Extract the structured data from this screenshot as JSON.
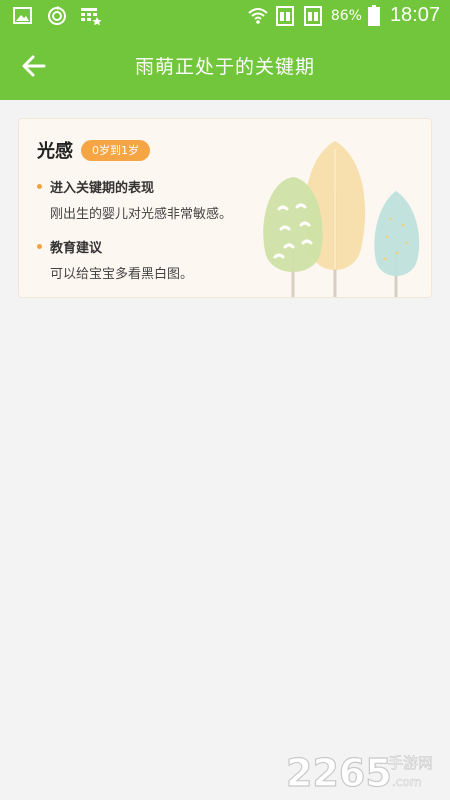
{
  "status_bar": {
    "battery_percent": "86%",
    "time": "18:07",
    "left_icons": [
      "image-icon",
      "refresh-icon",
      "app-grid-star-icon"
    ],
    "right_icons": [
      "wifi-icon",
      "sim1-icon",
      "sim2-icon",
      "battery-icon"
    ]
  },
  "app_bar": {
    "title": "雨萌正处于的关键期",
    "back_icon": "arrow-left-icon"
  },
  "card": {
    "title": "光感",
    "age_badge": "0岁到1岁",
    "sections": [
      {
        "heading": "进入关键期的表现",
        "text": "刚出生的婴儿对光感非常敏感。"
      },
      {
        "heading": "教育建议",
        "text": "可以给宝宝多看黑白图。"
      }
    ]
  },
  "watermark": {
    "number": "2265",
    "suffix": "手游网",
    "domain": ".com"
  },
  "colors": {
    "primary_green": "#72c63b",
    "badge_orange": "#f6a544",
    "bullet_orange": "#f4a13d",
    "card_bg": "#fdf7f2",
    "page_bg": "#f3f3f3"
  }
}
